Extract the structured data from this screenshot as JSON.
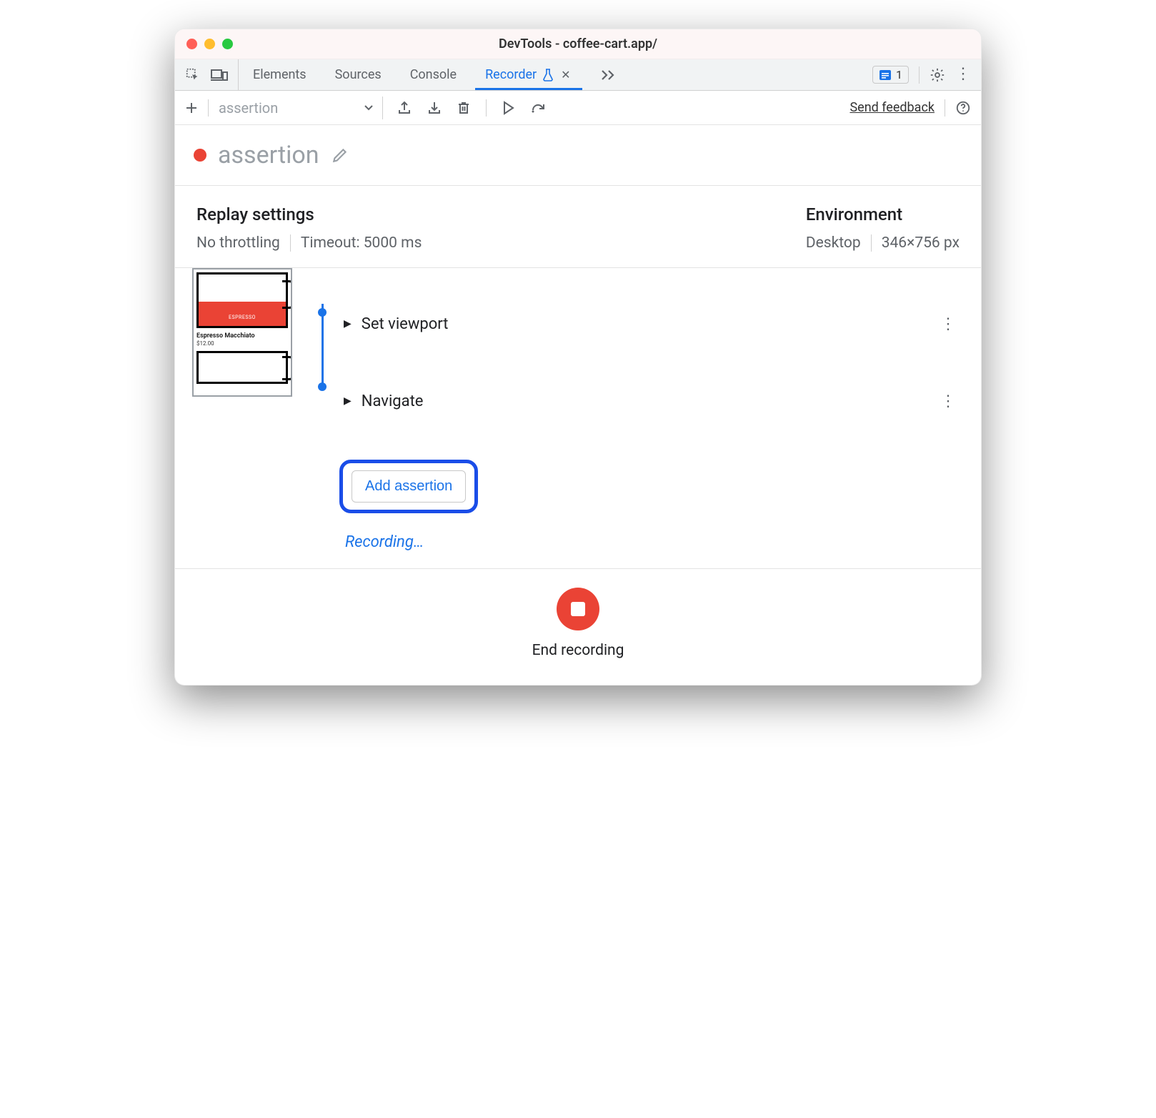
{
  "window": {
    "title": "DevTools - coffee-cart.app/"
  },
  "tabs": {
    "items": [
      "Elements",
      "Sources",
      "Console",
      "Recorder"
    ],
    "active": "Recorder"
  },
  "issues": {
    "count": "1"
  },
  "toolbar": {
    "selector_placeholder": "assertion",
    "send_feedback": "Send feedback"
  },
  "recording": {
    "name": "assertion",
    "status_text": "Recording…",
    "add_assertion_label": "Add assertion",
    "end_label": "End recording"
  },
  "replay_settings": {
    "header": "Replay settings",
    "throttling": "No throttling",
    "timeout": "Timeout: 5000 ms"
  },
  "environment": {
    "header": "Environment",
    "device": "Desktop",
    "viewport": "346×756 px"
  },
  "steps": [
    {
      "label": "Set viewport"
    },
    {
      "label": "Navigate"
    }
  ],
  "thumbnail": {
    "cup_label": "ESPRESSO",
    "caption": "Espresso Macchiato",
    "price": "$12.00"
  }
}
